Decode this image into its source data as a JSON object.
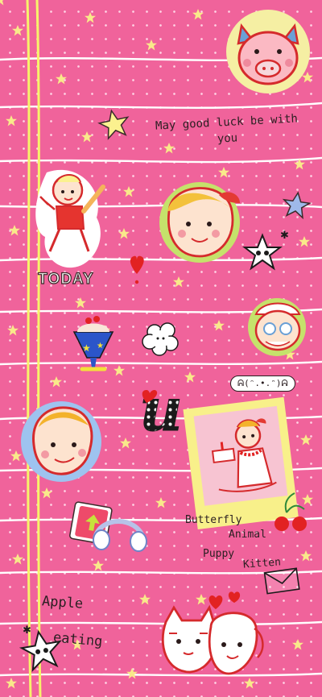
{
  "wallpaper": {
    "greeting": "May good luck be with you",
    "today_label": "TODAY",
    "kaomoji": "ᕱ(ᵔ.•.ᵔ)ᕱ",
    "letter": "u",
    "words": [
      "Butterfly",
      "Animal",
      "Puppy",
      "Kitten"
    ],
    "bottom_words": [
      "Apple",
      "eating"
    ],
    "colors": {
      "background": "#f0639b",
      "stripe": "#ffffff",
      "ribbon": "#f7f36a",
      "star": "#f9e98a",
      "outline": "#e0272b"
    }
  }
}
